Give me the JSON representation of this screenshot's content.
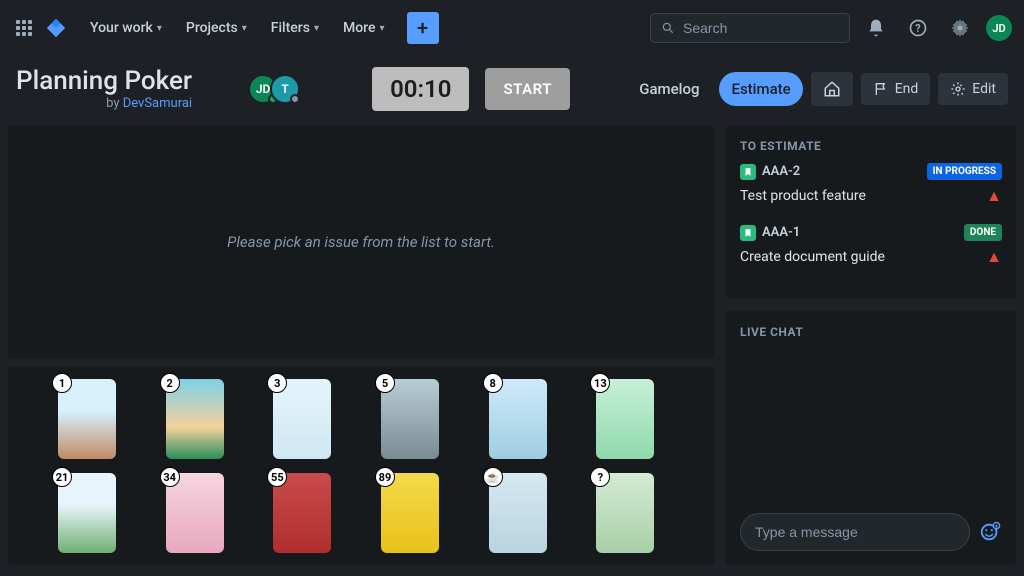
{
  "nav": {
    "your_work": "Your work",
    "projects": "Projects",
    "filters": "Filters",
    "more": "More"
  },
  "search": {
    "placeholder": "Search"
  },
  "user": {
    "initials": "JD"
  },
  "header": {
    "title": "Planning Poker",
    "by_prefix": "by ",
    "by_name": "DevSamurai",
    "participants": [
      {
        "initials": "JD",
        "bg": "#0a8754",
        "status": "#22a06b"
      },
      {
        "initials": "T",
        "bg": "#1d9aaa",
        "status": "#8696a7"
      }
    ],
    "timer": "00:10",
    "start": "START",
    "gamelog": "Gamelog",
    "estimate": "Estimate",
    "end": "End",
    "edit": "Edit"
  },
  "board": {
    "empty_msg": "Please pick an issue from the list to start."
  },
  "cards": [
    {
      "v": "1",
      "bg": "linear-gradient(#d7f0fb 40%,#c08b64)"
    },
    {
      "v": "2",
      "bg": "linear-gradient(#7fd1e8,#f3d19b 60%,#2a8f5a)"
    },
    {
      "v": "3",
      "bg": "linear-gradient(#e5f4fb,#cfe8f3)"
    },
    {
      "v": "5",
      "bg": "linear-gradient(#b9cdd6,#7a8a92)"
    },
    {
      "v": "8",
      "bg": "linear-gradient(#cfeaf7,#9ecde4)"
    },
    {
      "v": "13",
      "bg": "linear-gradient(#c8f0d8,#8fd9ac)"
    },
    {
      "v": "21",
      "bg": "linear-gradient(#e8f4fb 40%,#6fae72)"
    },
    {
      "v": "34",
      "bg": "linear-gradient(#f6d6e0,#e8a8bd)"
    },
    {
      "v": "55",
      "bg": "linear-gradient(#c94b4b,#b02e2e)"
    },
    {
      "v": "89",
      "bg": "linear-gradient(#f5d94b,#e8c21a)"
    },
    {
      "v": "☕",
      "bg": "linear-gradient(#d7e8f0,#b8d4e0)"
    },
    {
      "v": "?",
      "bg": "linear-gradient(#d4ead4,#a8d0a8)"
    }
  ],
  "estimate_panel": {
    "title": "TO ESTIMATE",
    "issues": [
      {
        "key": "AAA-2",
        "title": "Test product feature",
        "status_label": "IN PROGRESS",
        "status_class": "inprogress"
      },
      {
        "key": "AAA-1",
        "title": "Create document guide",
        "status_label": "DONE",
        "status_class": "done"
      }
    ]
  },
  "chat": {
    "title": "LIVE CHAT",
    "placeholder": "Type a message"
  }
}
